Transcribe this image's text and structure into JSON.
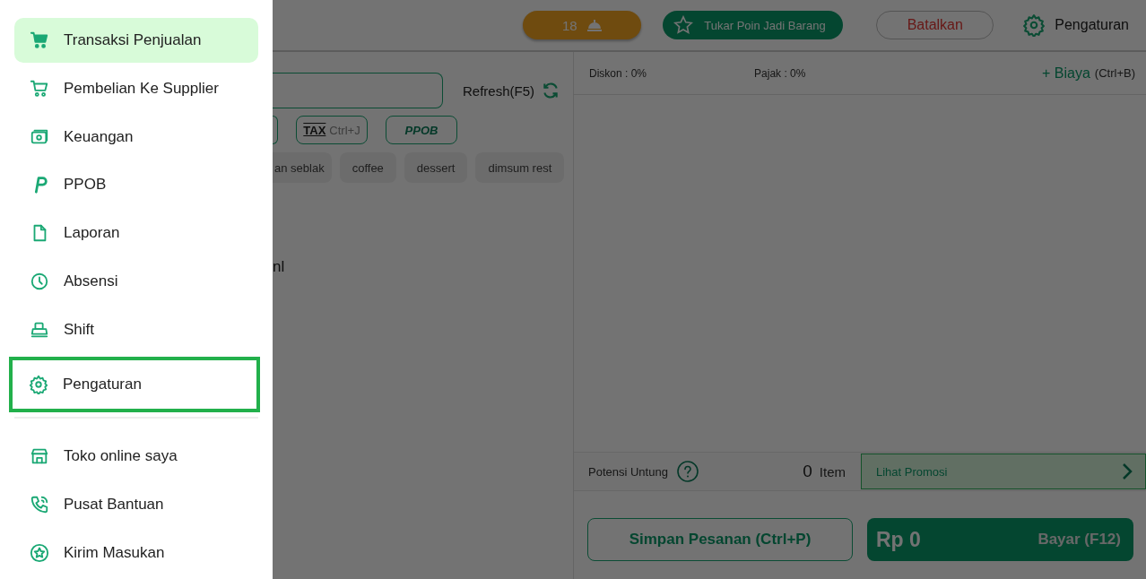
{
  "header": {
    "order_count": "18",
    "redeem_button": "Tukar Poin Jadi Barang",
    "cancel_button": "Batalkan",
    "settings_link": "Pengaturan"
  },
  "products": {
    "refresh": "Refresh(F5)",
    "shortcuts": [
      {
        "kind": "tax",
        "label": "TAX",
        "hint": "Ctrl+J"
      },
      {
        "kind": "ppob",
        "label": "PPOB"
      }
    ],
    "categories": [
      {
        "label": "an seblak",
        "selected": false
      },
      {
        "label": "coffee",
        "selected": false
      },
      {
        "label": "dessert",
        "selected": false
      },
      {
        "label": "dimsum rest",
        "selected": false
      }
    ],
    "partial_text": "nl"
  },
  "cart": {
    "discount": "Diskon : 0%",
    "tax": "Pajak : 0%",
    "add_fee": "+ Biaya",
    "add_fee_hint": "(Ctrl+B)",
    "profit_label": "Potensi Untung",
    "item_count": "0",
    "item_label": "Item",
    "promo": "Lihat Promosi",
    "save_button": "Simpan Pesanan (Ctrl+P)",
    "total": "Rp 0",
    "pay_button": "Bayar (F12)"
  },
  "menu": {
    "items": [
      {
        "label": "Transaksi Penjualan",
        "selected": true,
        "highlighted": false
      },
      {
        "label": "Pembelian Ke Supplier",
        "selected": false,
        "highlighted": false
      },
      {
        "label": "Keuangan",
        "selected": false,
        "highlighted": false
      },
      {
        "label": "PPOB",
        "selected": false,
        "highlighted": false
      },
      {
        "label": "Laporan",
        "selected": false,
        "highlighted": false
      },
      {
        "label": "Absensi",
        "selected": false,
        "highlighted": false
      },
      {
        "label": "Shift",
        "selected": false,
        "highlighted": false
      },
      {
        "label": "Pengaturan",
        "selected": false,
        "highlighted": true
      }
    ],
    "extra_items": [
      {
        "label": "Toko online saya"
      },
      {
        "label": "Pusat Bantuan"
      },
      {
        "label": "Kirim Masukan"
      }
    ]
  }
}
